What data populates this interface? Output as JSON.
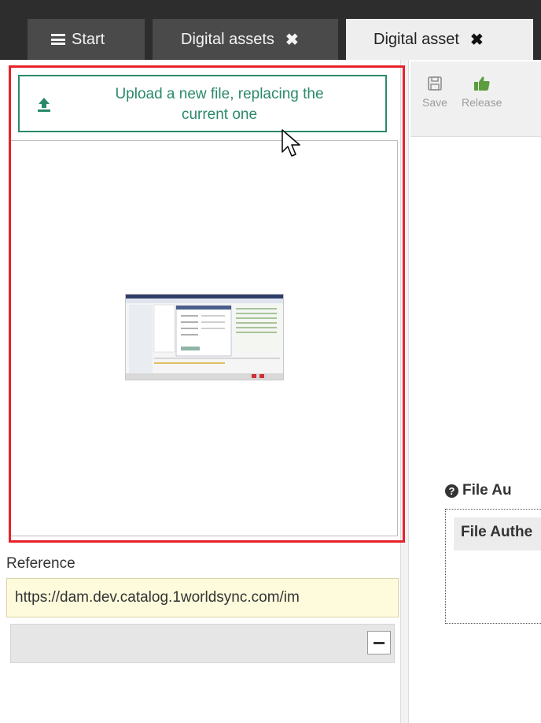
{
  "tabs": [
    {
      "label": "Start",
      "icon": "menu-icon",
      "active": false
    },
    {
      "label": "Digital assets",
      "closable": true,
      "active": false
    },
    {
      "label": "Digital asset",
      "closable": true,
      "active": true
    }
  ],
  "left_panel": {
    "upload_button": {
      "label_line1": "Upload a new file, replacing the",
      "label_line2": "current one",
      "icon": "upload-icon",
      "color": "#2a8a67"
    },
    "preview_icon": "file-preview-thumbnail",
    "reference": {
      "label": "Reference",
      "value": "https://dam.dev.catalog.1worldsync.com/im"
    },
    "collapse_icon": "minus-icon"
  },
  "toolbar": {
    "save_label": "Save",
    "release_label": "Release"
  },
  "file_auth": {
    "title": "File Au",
    "table_header": "File Authe"
  },
  "colors": {
    "tabbar_bg": "#2d2d2d",
    "highlight_frame": "#e8222a",
    "reference_bg": "#fefbdc"
  }
}
